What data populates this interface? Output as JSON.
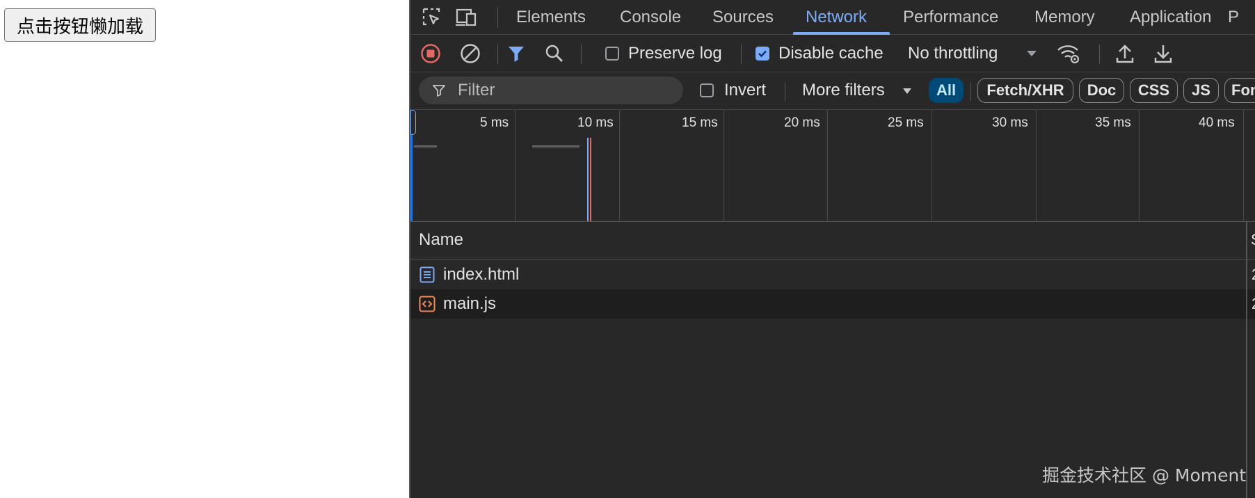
{
  "page": {
    "button_label": "点击按钮懒加载"
  },
  "devtools": {
    "tabs": [
      "Elements",
      "Console",
      "Sources",
      "Network",
      "Performance",
      "Memory",
      "Application",
      "P"
    ],
    "active_tab": "Network",
    "toolbar": {
      "preserve_log_label": "Preserve log",
      "preserve_log_checked": false,
      "disable_cache_label": "Disable cache",
      "disable_cache_checked": true,
      "throttling_value": "No throttling"
    },
    "filterbar": {
      "filter_placeholder": "Filter",
      "invert_label": "Invert",
      "more_filters_label": "More filters",
      "type_filters": [
        "All",
        "Fetch/XHR",
        "Doc",
        "CSS",
        "JS",
        "Fon"
      ],
      "active_type_filter": "All"
    },
    "overview": {
      "ticks": [
        "5 ms",
        "10 ms",
        "15 ms",
        "20 ms",
        "25 ms",
        "30 ms",
        "35 ms",
        "40 ms"
      ]
    },
    "table": {
      "name_header": "Name",
      "next_header_fragment": "S",
      "rows": [
        {
          "name": "index.html",
          "icon": "document-icon",
          "next_col_fragment": "2"
        },
        {
          "name": "main.js",
          "icon": "script-icon",
          "next_col_fragment": "2"
        }
      ]
    },
    "watermark": "掘金技术社区 @ Moment"
  },
  "colors": {
    "panel_bg": "#282828",
    "accent": "#7cacf8",
    "record_red": "#e46962",
    "active_pill_bg": "#004a77",
    "script_orange": "#f28b54"
  }
}
